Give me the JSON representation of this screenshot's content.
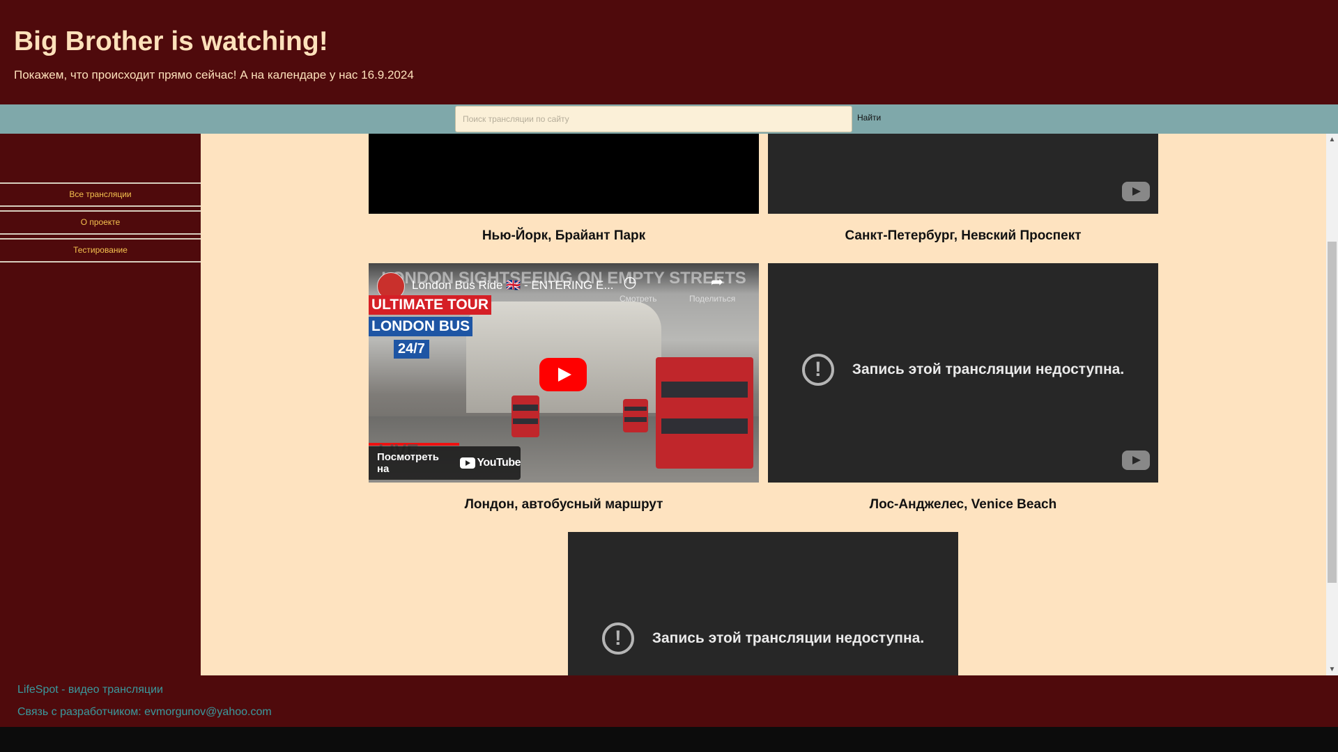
{
  "header": {
    "title": "Big Brother is watching!",
    "subtitle": "Покажем, что происходит прямо сейчас! А на календаре у нас 16.9.2024"
  },
  "search": {
    "placeholder": "Поиск трансляции по сайту",
    "value": "",
    "button_label": "Найти"
  },
  "sidebar": {
    "items": [
      {
        "label": "Все трансляции"
      },
      {
        "label": "О проекте"
      },
      {
        "label": "Тестирование"
      }
    ]
  },
  "videos": [
    {
      "caption": "Нью-Йорк, Брайант Парк",
      "state": "black"
    },
    {
      "caption": "Санкт-Петербург, Невский Проспект",
      "state": "unavailable"
    },
    {
      "caption": "Лондон, автобусный маршрут",
      "state": "playable",
      "player_title": "London Bus Ride 🇬🇧 - ENTERING E...",
      "overlay_text": "LONDON SIGHTSEEING ON EMPTY STREETS",
      "watch_later_label": "Смотреть",
      "share_label": "Поделиться",
      "badge_tour": "ULTIMATE TOUR",
      "badge_bus": "LONDON BUS",
      "badge_247": "24/7",
      "watch_on_label": "Посмотреть на",
      "youtube_label": "YouTube",
      "live_label": "LIVE"
    },
    {
      "caption": "Лос-Анджелес, Venice Beach",
      "state": "unavailable",
      "unavailable_text": "Запись этой трансляции недоступна."
    },
    {
      "caption": "",
      "state": "unavailable",
      "unavailable_text": "Запись этой трансляции недоступна."
    }
  ],
  "footer": {
    "line1": "LifeSpot - видео трансляции",
    "line2": "Связь с разработчиком: evmorgunov@yahoo.com"
  },
  "colors": {
    "header_bg": "#4f0a0c",
    "title_text": "#fde1bb",
    "search_bar_bg": "#7fa8aa",
    "content_bg": "#fee3c0",
    "nav_text": "#f5c24f",
    "footer_text": "#3a9a9e",
    "player_dark": "#272727",
    "youtube_red": "#ff0000"
  },
  "icons": {
    "warning": "exclamation-circle-icon",
    "youtube": "youtube-logo-icon",
    "play": "play-icon",
    "clock": "clock-icon",
    "share": "share-icon"
  }
}
